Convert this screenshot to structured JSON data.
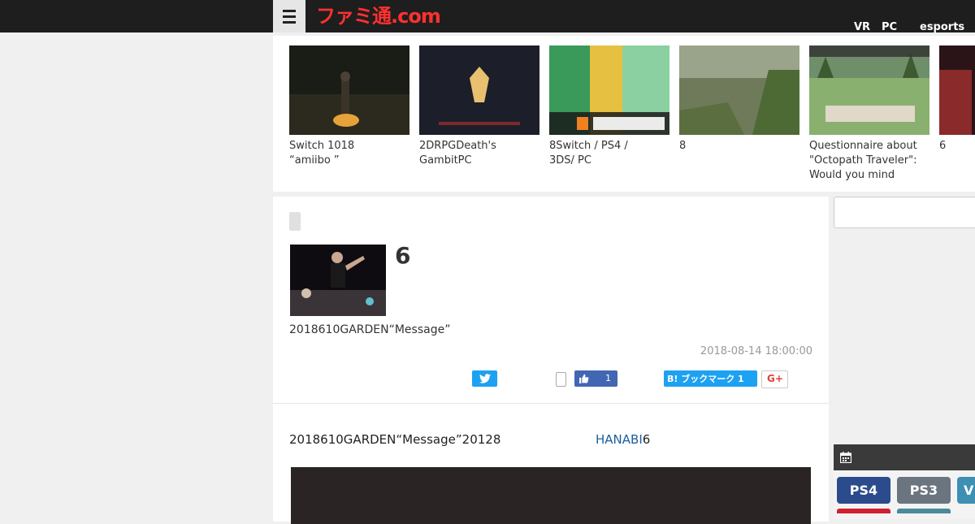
{
  "header": {
    "logo_text": "ファミ通.com",
    "nav": [
      "VR",
      "PC",
      "esports"
    ]
  },
  "carousel": {
    "items": [
      {
        "caption_lines": [
          "Switch 1018",
          "“amiibo ”"
        ]
      },
      {
        "caption_lines": [
          "2DRPGDeath's",
          "GambitPC"
        ]
      },
      {
        "caption_lines": [
          "8Switch / PS4 /",
          "3DS/ PC"
        ]
      },
      {
        "caption_lines": [
          "8"
        ]
      },
      {
        "caption_lines": [
          "Questionnaire about",
          "\"Octopath Traveler\":",
          "Would you mind"
        ]
      },
      {
        "caption_lines": [
          "6"
        ]
      }
    ]
  },
  "article": {
    "title": "6",
    "lead": "2018610GARDEN“Message”",
    "date": "2018-08-14 18:00:00",
    "share": {
      "facebook_count": "1",
      "hatena_label": "B! ブックマーク 1",
      "gplus_label": "G+"
    },
    "body_text": "2018610GARDEN“Message”20128",
    "body_link": "HANABI",
    "body_text_after": "6"
  },
  "sidebar": {
    "platforms": [
      {
        "label": "PS4",
        "color": "#2b4b8c"
      },
      {
        "label": "PS3",
        "color": "#6b7580"
      },
      {
        "label": "V",
        "color": "#3d8fb3"
      }
    ]
  }
}
